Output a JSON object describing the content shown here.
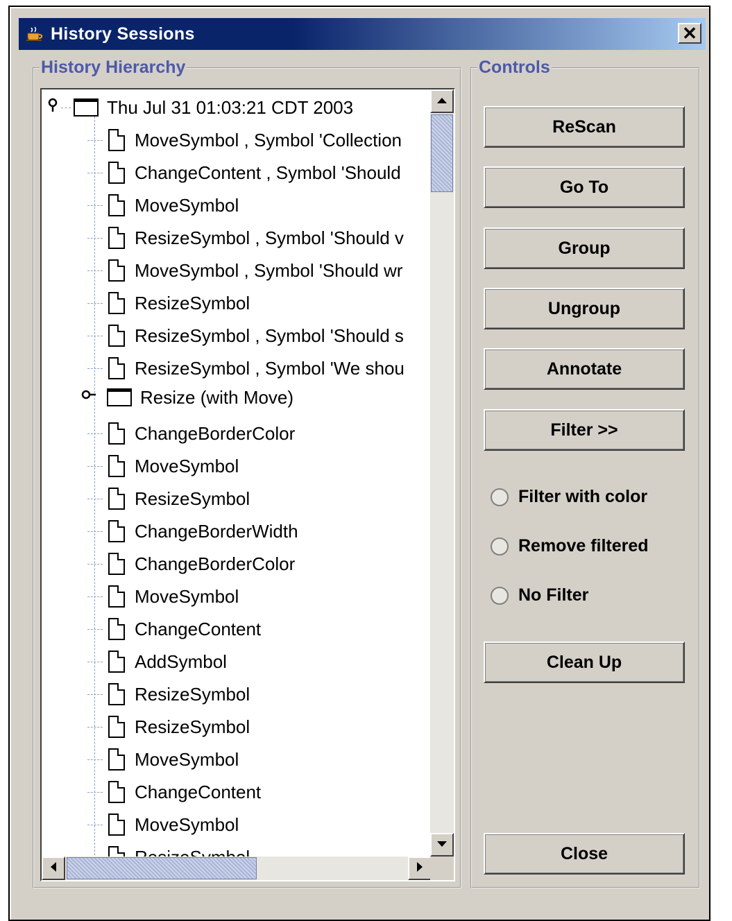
{
  "window": {
    "title": "History Sessions",
    "close_glyph": "✕",
    "icon": "java-cup-icon"
  },
  "history": {
    "legend": "History Hierarchy",
    "root_label": "Thu Jul 31 01:03:21 CDT 2003",
    "items_a": [
      "MoveSymbol , Symbol 'Collection",
      "ChangeContent , Symbol 'Should",
      "MoveSymbol",
      "ResizeSymbol , Symbol 'Should v",
      "MoveSymbol , Symbol 'Should wr",
      "ResizeSymbol",
      "ResizeSymbol , Symbol 'Should s",
      "ResizeSymbol , Symbol 'We shou"
    ],
    "group_label": "Resize (with Move)",
    "items_b": [
      "ChangeBorderColor",
      "MoveSymbol",
      "ResizeSymbol",
      "ChangeBorderWidth",
      "ChangeBorderColor",
      "MoveSymbol",
      "ChangeContent",
      "AddSymbol",
      "ResizeSymbol",
      "ResizeSymbol",
      "MoveSymbol",
      "ChangeContent",
      "MoveSymbol",
      "ResizeSymbol"
    ]
  },
  "controls": {
    "legend": "Controls",
    "rescan": "ReScan",
    "goto": "Go To",
    "group": "Group",
    "ungroup": "Ungroup",
    "annotate": "Annotate",
    "filter": "Filter >>",
    "radio_filter_color": "Filter with color",
    "radio_remove_filtered": "Remove filtered",
    "radio_no_filter": "No Filter",
    "cleanup": "Clean Up",
    "close": "Close"
  }
}
